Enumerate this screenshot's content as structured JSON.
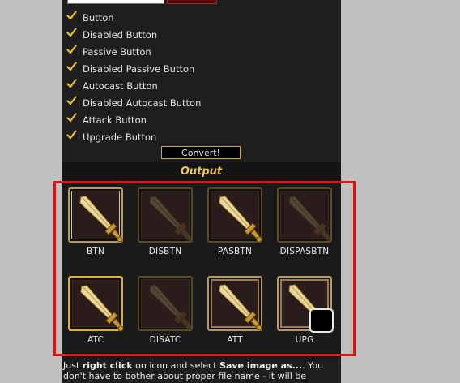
{
  "options": [
    {
      "label": "Button",
      "checked": true
    },
    {
      "label": "Disabled Button",
      "checked": true
    },
    {
      "label": "Passive Button",
      "checked": true
    },
    {
      "label": "Disabled Passive Button",
      "checked": true
    },
    {
      "label": "Autocast Button",
      "checked": true
    },
    {
      "label": "Disabled Autocast Button",
      "checked": true
    },
    {
      "label": "Attack Button",
      "checked": true
    },
    {
      "label": "Upgrade Button",
      "checked": true
    }
  ],
  "convert_label": "Convert!",
  "output_title": "Output",
  "icons": [
    {
      "label": "BTN",
      "style": "normal"
    },
    {
      "label": "DISBTN",
      "style": "disabled"
    },
    {
      "label": "PASBTN",
      "style": "passive"
    },
    {
      "label": "DISPASBTN",
      "style": "disabled-passive"
    },
    {
      "label": "ATC",
      "style": "autocast"
    },
    {
      "label": "DISATC",
      "style": "disabled-autocast"
    },
    {
      "label": "ATT",
      "style": "attack"
    },
    {
      "label": "UPG",
      "style": "upgrade"
    }
  ],
  "footer": {
    "t1": "Just ",
    "b1": "right click",
    "t2": " on icon and select ",
    "b2": "Save image as...",
    "t3": ". You don't have to bother about proper file name - it will be"
  },
  "colors": {
    "accent_gold": "#c9a64a",
    "highlight_red": "#d01818",
    "panel_bg": "#1e1e1e"
  }
}
